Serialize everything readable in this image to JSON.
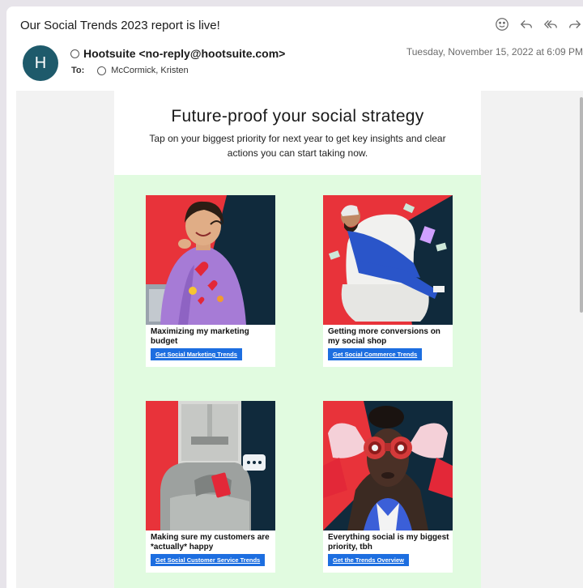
{
  "email": {
    "subject": "Our Social Trends 2023 report is live!",
    "avatar_initial": "H",
    "from": "Hootsuite <no-reply@hootsuite.com>",
    "to_label": "To:",
    "to_name": "McCormick, Kristen",
    "date": "Tuesday, November 15, 2022 at 6:09 PM"
  },
  "toolbar": {
    "icons": [
      "smiley-icon",
      "reply-icon",
      "reply-all-icon",
      "forward-icon"
    ]
  },
  "content": {
    "headline": "Future-proof your social strategy",
    "subline": "Tap on your biggest priority for next year to get key insights and clear actions you can start taking now.",
    "tiles": [
      {
        "caption": "Maximizing my marketing budget",
        "button": "Get Social Marketing Trends"
      },
      {
        "caption": "Getting more conversions on my social shop",
        "button": "Get Social Commerce Trends"
      },
      {
        "caption": "Making sure my customers are *actually* happy",
        "button": "Get Social Customer Service Trends"
      },
      {
        "caption": "Everything social is my biggest priority, tbh",
        "button": "Get the Trends Overview"
      }
    ]
  },
  "colors": {
    "accent_button": "#1d6ee0",
    "green_bg": "#e1fbe0",
    "avatar": "#1e5a6b",
    "tile_red": "#e8333a",
    "tile_navy": "#102a3c"
  }
}
